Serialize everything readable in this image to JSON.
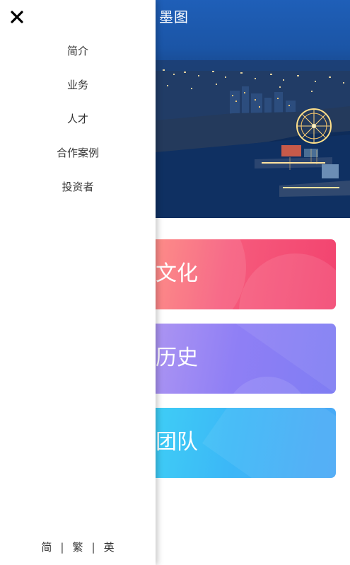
{
  "header": {
    "brand": "墨图",
    "user_icon": "user-icon"
  },
  "cards": [
    {
      "label": "文化",
      "color": "#f65b7c"
    },
    {
      "label": "历史",
      "color": "#8f7ff5"
    },
    {
      "label": "团队",
      "color": "#3cb7f7"
    }
  ],
  "drawer": {
    "close_icon": "close-icon",
    "menu": [
      {
        "label": "简介"
      },
      {
        "label": "业务"
      },
      {
        "label": "人才"
      },
      {
        "label": "合作案例"
      },
      {
        "label": "投资者"
      }
    ],
    "languages": [
      "简",
      "繁",
      "英"
    ],
    "language_separator": "|"
  },
  "colors": {
    "hero_sky": "#1b55a6",
    "hero_water": "#0e2c5a",
    "drawer_bg": "#ffffff",
    "text": "#333333"
  }
}
